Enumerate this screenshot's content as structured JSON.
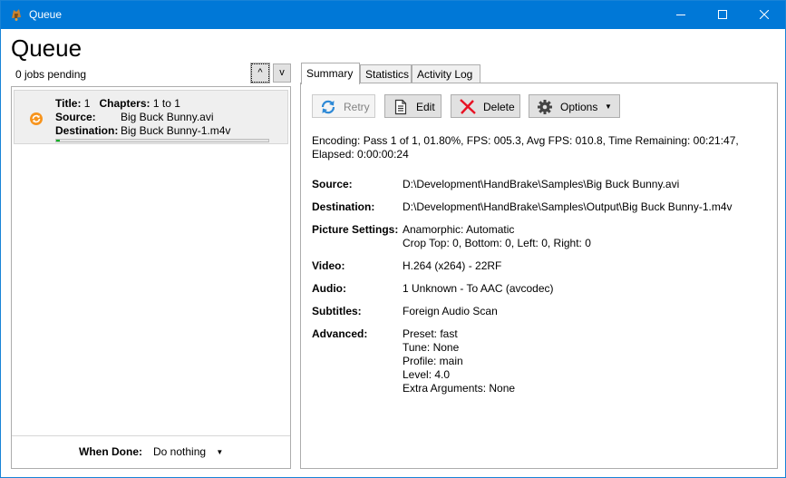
{
  "window": {
    "title": "Queue"
  },
  "page": {
    "title": "Queue",
    "jobs_pending": "0 jobs pending",
    "move_up_label": "^",
    "move_down_label": "v"
  },
  "queue_items": [
    {
      "title_label": "Title:",
      "title_value": "1",
      "chapters_label": "Chapters:",
      "chapters_value": "1  to  1",
      "source_label": "Source:",
      "source_value": "Big Buck Bunny.avi",
      "destination_label": "Destination:",
      "destination_value": "Big Buck Bunny-1.m4v",
      "progress_percent": 1.8,
      "status_icon": "encoding-in-progress-icon"
    }
  ],
  "when_done": {
    "label": "When Done:",
    "value": "Do nothing"
  },
  "tabs": [
    {
      "label": "Summary",
      "active": true
    },
    {
      "label": "Statistics",
      "active": false
    },
    {
      "label": "Activity Log",
      "active": false
    }
  ],
  "toolbar": {
    "retry_label": "Retry",
    "edit_label": "Edit",
    "delete_label": "Delete",
    "options_label": "Options"
  },
  "summary": {
    "encoding_status": "Encoding: Pass 1 of 1,  01.80%, FPS: 005.3,  Avg FPS: 010.8,  Time Remaining: 00:21:47,  Elapsed: 0:00:00:24",
    "source_label": "Source:",
    "source_value": "D:\\Development\\HandBrake\\Samples\\Big Buck Bunny.avi",
    "destination_label": "Destination:",
    "destination_value": "D:\\Development\\HandBrake\\Samples\\Output\\Big Buck Bunny-1.m4v",
    "picture_label": "Picture Settings:",
    "picture_line1": "Anamorphic: Automatic",
    "picture_line2": "Crop Top: 0, Bottom: 0, Left: 0, Right: 0",
    "video_label": "Video:",
    "video_value": "H.264 (x264) - 22RF",
    "audio_label": "Audio:",
    "audio_value": "1 Unknown -  To AAC (avcodec)",
    "subtitles_label": "Subtitles:",
    "subtitles_value": "Foreign Audio Scan",
    "advanced_label": "Advanced:",
    "advanced_lines": [
      "Preset: fast",
      "Tune: None",
      "Profile: main",
      "Level: 4.0",
      "Extra Arguments: None"
    ]
  },
  "colors": {
    "titlebar": "#0078d7",
    "progress": "#06b025",
    "delete_x": "#e81123",
    "retry_icon": "#2d89d6"
  }
}
